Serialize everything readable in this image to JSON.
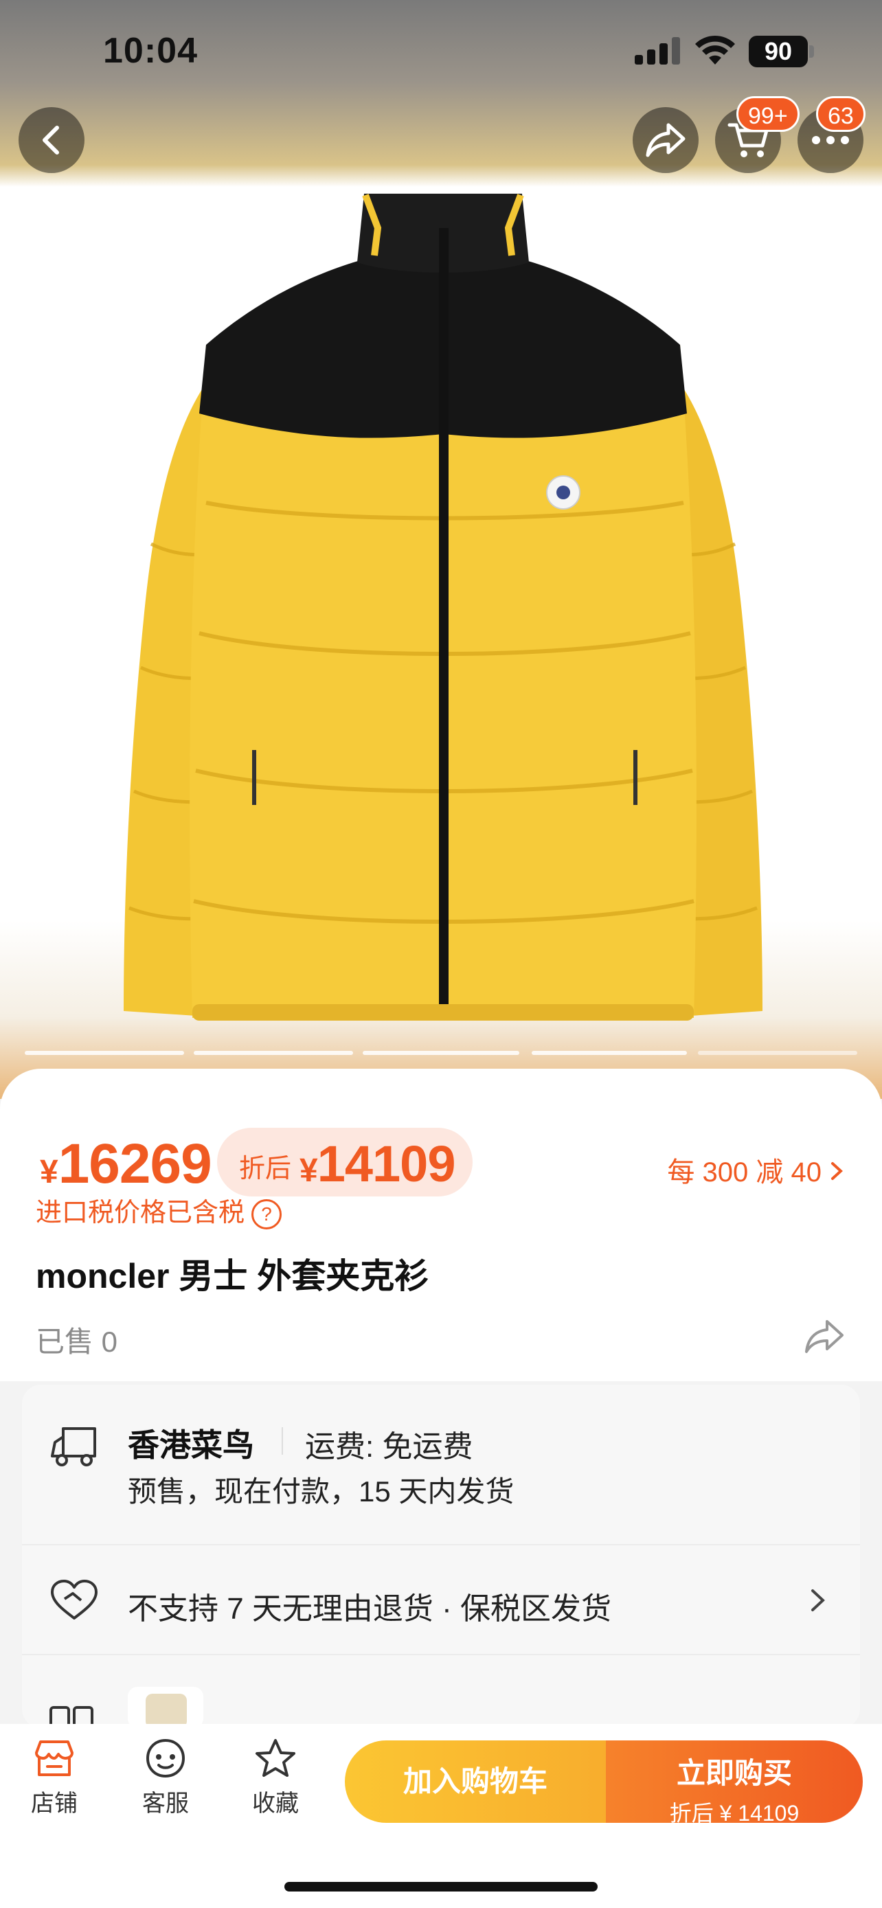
{
  "status_bar": {
    "time": "10:04",
    "battery": "90"
  },
  "header": {
    "cart_badge": "99+",
    "more_badge": "63"
  },
  "product": {
    "price_currency": "¥",
    "price": "16269",
    "discount_label": "折后",
    "discount_currency": "¥",
    "discount_price": "14109",
    "promo": "每 300 减 40",
    "tax_note": "进口税价格已含税",
    "tax_help": "?",
    "title": "moncler 男士 外套夹克衫",
    "sold": "已售 0"
  },
  "delivery": {
    "ship_from": "香港菜鸟",
    "freight": "运费: 免运费",
    "presale": "预售，现在付款，15 天内发货",
    "return_policy": "不支持 7 天无理由退货 · 保税区发货"
  },
  "bottom_bar": {
    "store": "店铺",
    "service": "客服",
    "favorite": "收藏",
    "add_to_cart": "加入购物车",
    "buy_now": "立即购买",
    "buy_now_sub": "折后 ¥ 14109"
  },
  "colors": {
    "accent": "#f05a22",
    "cart_button": "#fbc633",
    "buy_button": "#f05a22"
  }
}
